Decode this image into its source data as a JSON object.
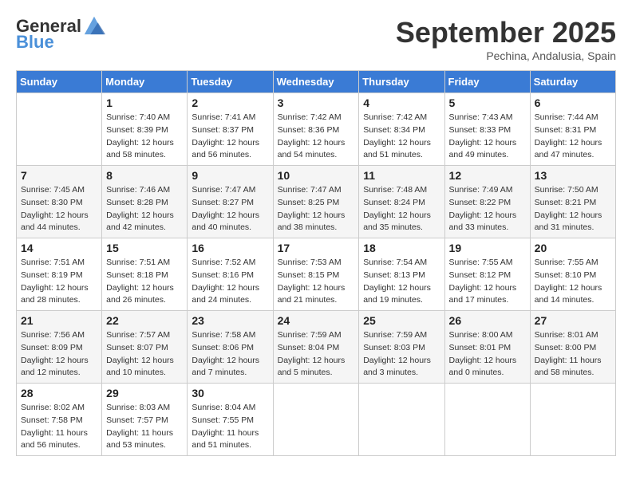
{
  "header": {
    "logo_general": "General",
    "logo_blue": "Blue",
    "month": "September 2025",
    "location": "Pechina, Andalusia, Spain"
  },
  "days_of_week": [
    "Sunday",
    "Monday",
    "Tuesday",
    "Wednesday",
    "Thursday",
    "Friday",
    "Saturday"
  ],
  "weeks": [
    [
      {
        "day": "",
        "info": ""
      },
      {
        "day": "1",
        "info": "Sunrise: 7:40 AM\nSunset: 8:39 PM\nDaylight: 12 hours\nand 58 minutes."
      },
      {
        "day": "2",
        "info": "Sunrise: 7:41 AM\nSunset: 8:37 PM\nDaylight: 12 hours\nand 56 minutes."
      },
      {
        "day": "3",
        "info": "Sunrise: 7:42 AM\nSunset: 8:36 PM\nDaylight: 12 hours\nand 54 minutes."
      },
      {
        "day": "4",
        "info": "Sunrise: 7:42 AM\nSunset: 8:34 PM\nDaylight: 12 hours\nand 51 minutes."
      },
      {
        "day": "5",
        "info": "Sunrise: 7:43 AM\nSunset: 8:33 PM\nDaylight: 12 hours\nand 49 minutes."
      },
      {
        "day": "6",
        "info": "Sunrise: 7:44 AM\nSunset: 8:31 PM\nDaylight: 12 hours\nand 47 minutes."
      }
    ],
    [
      {
        "day": "7",
        "info": "Sunrise: 7:45 AM\nSunset: 8:30 PM\nDaylight: 12 hours\nand 44 minutes."
      },
      {
        "day": "8",
        "info": "Sunrise: 7:46 AM\nSunset: 8:28 PM\nDaylight: 12 hours\nand 42 minutes."
      },
      {
        "day": "9",
        "info": "Sunrise: 7:47 AM\nSunset: 8:27 PM\nDaylight: 12 hours\nand 40 minutes."
      },
      {
        "day": "10",
        "info": "Sunrise: 7:47 AM\nSunset: 8:25 PM\nDaylight: 12 hours\nand 38 minutes."
      },
      {
        "day": "11",
        "info": "Sunrise: 7:48 AM\nSunset: 8:24 PM\nDaylight: 12 hours\nand 35 minutes."
      },
      {
        "day": "12",
        "info": "Sunrise: 7:49 AM\nSunset: 8:22 PM\nDaylight: 12 hours\nand 33 minutes."
      },
      {
        "day": "13",
        "info": "Sunrise: 7:50 AM\nSunset: 8:21 PM\nDaylight: 12 hours\nand 31 minutes."
      }
    ],
    [
      {
        "day": "14",
        "info": "Sunrise: 7:51 AM\nSunset: 8:19 PM\nDaylight: 12 hours\nand 28 minutes."
      },
      {
        "day": "15",
        "info": "Sunrise: 7:51 AM\nSunset: 8:18 PM\nDaylight: 12 hours\nand 26 minutes."
      },
      {
        "day": "16",
        "info": "Sunrise: 7:52 AM\nSunset: 8:16 PM\nDaylight: 12 hours\nand 24 minutes."
      },
      {
        "day": "17",
        "info": "Sunrise: 7:53 AM\nSunset: 8:15 PM\nDaylight: 12 hours\nand 21 minutes."
      },
      {
        "day": "18",
        "info": "Sunrise: 7:54 AM\nSunset: 8:13 PM\nDaylight: 12 hours\nand 19 minutes."
      },
      {
        "day": "19",
        "info": "Sunrise: 7:55 AM\nSunset: 8:12 PM\nDaylight: 12 hours\nand 17 minutes."
      },
      {
        "day": "20",
        "info": "Sunrise: 7:55 AM\nSunset: 8:10 PM\nDaylight: 12 hours\nand 14 minutes."
      }
    ],
    [
      {
        "day": "21",
        "info": "Sunrise: 7:56 AM\nSunset: 8:09 PM\nDaylight: 12 hours\nand 12 minutes."
      },
      {
        "day": "22",
        "info": "Sunrise: 7:57 AM\nSunset: 8:07 PM\nDaylight: 12 hours\nand 10 minutes."
      },
      {
        "day": "23",
        "info": "Sunrise: 7:58 AM\nSunset: 8:06 PM\nDaylight: 12 hours\nand 7 minutes."
      },
      {
        "day": "24",
        "info": "Sunrise: 7:59 AM\nSunset: 8:04 PM\nDaylight: 12 hours\nand 5 minutes."
      },
      {
        "day": "25",
        "info": "Sunrise: 7:59 AM\nSunset: 8:03 PM\nDaylight: 12 hours\nand 3 minutes."
      },
      {
        "day": "26",
        "info": "Sunrise: 8:00 AM\nSunset: 8:01 PM\nDaylight: 12 hours\nand 0 minutes."
      },
      {
        "day": "27",
        "info": "Sunrise: 8:01 AM\nSunset: 8:00 PM\nDaylight: 11 hours\nand 58 minutes."
      }
    ],
    [
      {
        "day": "28",
        "info": "Sunrise: 8:02 AM\nSunset: 7:58 PM\nDaylight: 11 hours\nand 56 minutes."
      },
      {
        "day": "29",
        "info": "Sunrise: 8:03 AM\nSunset: 7:57 PM\nDaylight: 11 hours\nand 53 minutes."
      },
      {
        "day": "30",
        "info": "Sunrise: 8:04 AM\nSunset: 7:55 PM\nDaylight: 11 hours\nand 51 minutes."
      },
      {
        "day": "",
        "info": ""
      },
      {
        "day": "",
        "info": ""
      },
      {
        "day": "",
        "info": ""
      },
      {
        "day": "",
        "info": ""
      }
    ]
  ]
}
